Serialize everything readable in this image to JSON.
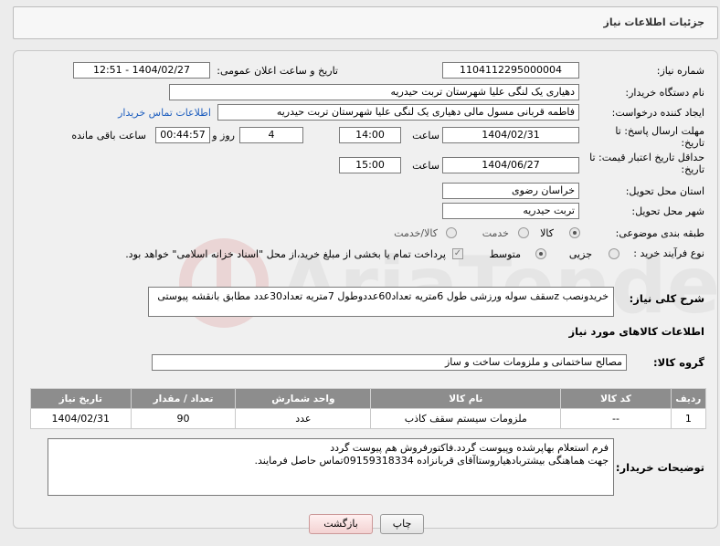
{
  "header": {
    "title": "جزئیات اطلاعات نیاز"
  },
  "fields": {
    "need_number_label": "شماره نیاز:",
    "need_number": "1104112295000004",
    "announce_label": "تاریخ و ساعت اعلان عمومی:",
    "announce_value": "1404/02/27 - 12:51",
    "buyer_org_label": "نام دستگاه خریدار:",
    "buyer_org": "دهیاری یک لنگی علیا  شهرستان تربت حیدریه",
    "creator_label": "ایجاد کننده درخواست:",
    "creator": "فاطمه قربانی مسول مالی دهیاری یک لنگی علیا  شهرستان تربت حیدریه",
    "contact_link": "اطلاعات تماس خریدار",
    "reply_deadline_label": "مهلت ارسال پاسخ: تا تاریخ:",
    "reply_date": "1404/02/31",
    "time_label": "ساعت",
    "reply_time": "14:00",
    "days_value": "4",
    "days_label": "روز و",
    "remaining_time": "00:44:57",
    "remaining_label": "ساعت باقی مانده",
    "validity_label": "حداقل تاریخ اعتبار قیمت: تا تاریخ:",
    "validity_date": "1404/06/27",
    "validity_time_label": "ساعت",
    "validity_time": "15:00",
    "province_label": "استان محل تحویل:",
    "province": "خراسان رضوی",
    "city_label": "شهر محل تحویل:",
    "city": "تربت حیدریه",
    "category_label": "طبقه بندی موضوعی:",
    "category_options": [
      "کالا",
      "خدمت",
      "کالا/خدمت"
    ],
    "process_label": "نوع فرآیند خرید :",
    "process_options": [
      "جزیی",
      "متوسط"
    ],
    "payment_note": "پرداخت تمام یا بخشی از مبلغ خرید،از محل \"اسناد خزانه اسلامی\" خواهد بود."
  },
  "description": {
    "label": "شرح کلی نیاز:",
    "text": "خریدونصب zسقف سوله ورزشی طول 6متریه تعداد60عددوطول 7متریه تعداد30عدد مطابق بانقشه پیوستی"
  },
  "goods": {
    "section_title": "اطلاعات کالاهای مورد نیاز",
    "group_label": "گروه کالا:",
    "group_value": "مصالح ساختمانی و ملزومات ساخت و ساز",
    "columns": [
      "ردیف",
      "کد کالا",
      "نام کالا",
      "واحد شمارش",
      "تعداد / مقدار",
      "تاریخ نیاز"
    ],
    "rows": [
      [
        "1",
        "--",
        "ملزومات سیستم سقف کاذب",
        "عدد",
        "90",
        "1404/02/31"
      ]
    ]
  },
  "buyer_notes": {
    "label": "توضیحات خریدار:",
    "line1": "فرم استعلام بهاپرشده وپیوست گردد.فاکتورفروش هم پیوست گردد",
    "line2": "جهت هماهنگی بیشتربادهیاروستاآقای قربانزاده 09159318334تماس حاصل فرمایند."
  },
  "buttons": {
    "print": "چاپ",
    "back": "بازگشت"
  },
  "colors": {
    "table_header": "#8d8d8d",
    "link": "#1f5fbf",
    "watermark": "#c62828"
  }
}
